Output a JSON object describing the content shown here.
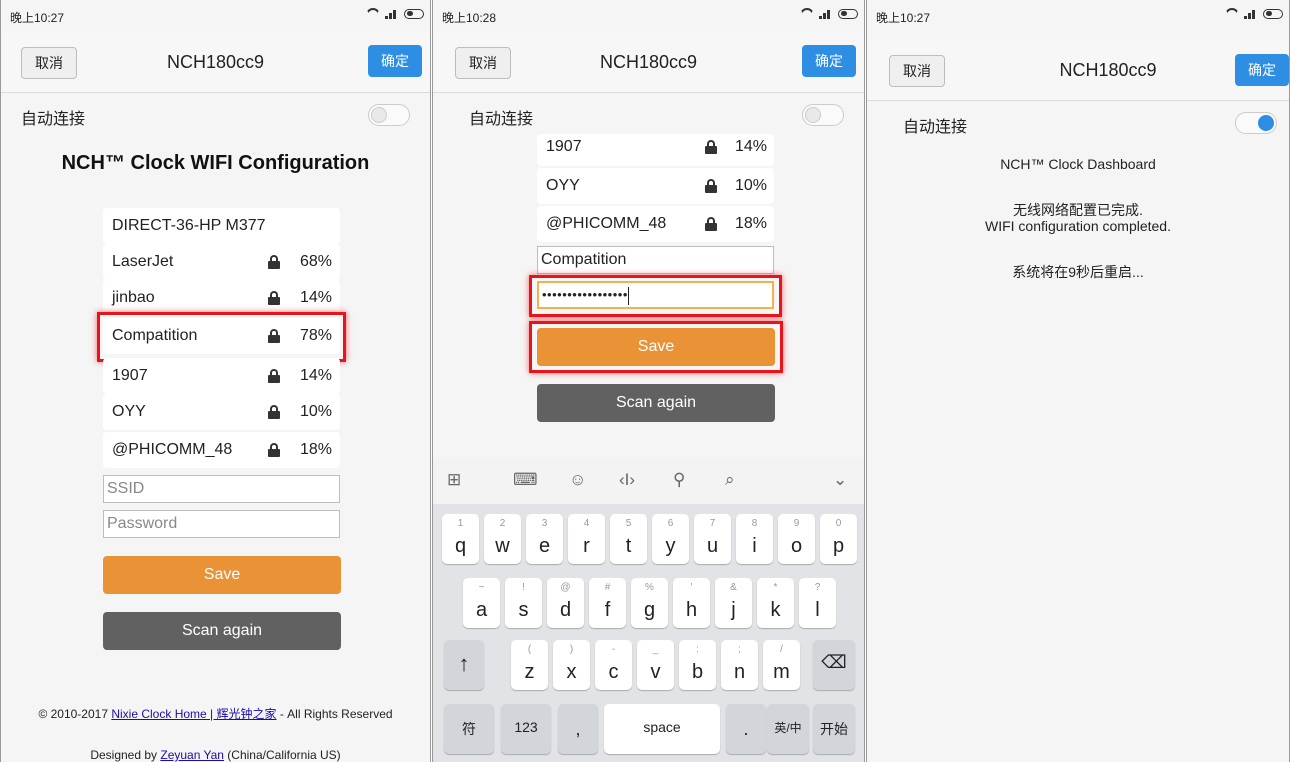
{
  "panel1": {
    "status": {
      "time": "晚上10:27"
    },
    "nav": {
      "cancel": "取消",
      "title": "NCH180cc9",
      "ok": "确定"
    },
    "auto_connect": "自动连接",
    "config_title": "NCH™ Clock WIFI Configuration",
    "networks": [
      {
        "ssid": "DIRECT-36-HP M377",
        "locked": false,
        "signal": ""
      },
      {
        "ssid": "LaserJet",
        "locked": true,
        "signal": "68%"
      },
      {
        "ssid": "jinbao",
        "locked": true,
        "signal": "14%"
      },
      {
        "ssid": "Compatition",
        "locked": true,
        "signal": "78%"
      },
      {
        "ssid": "1907",
        "locked": true,
        "signal": "14%"
      },
      {
        "ssid": "OYY",
        "locked": true,
        "signal": "10%"
      },
      {
        "ssid": "@PHICOMM_48",
        "locked": true,
        "signal": "18%"
      }
    ],
    "ssid_placeholder": "SSID",
    "password_placeholder": "Password",
    "save": "Save",
    "scan_again": "Scan again",
    "footer": {
      "copyright_prefix": "© 2010-2017 ",
      "site_link": "Nixie Clock Home | 辉光钟之家",
      "copyright_suffix": " - All Rights Reserved",
      "designed_prefix": "Designed by ",
      "designer_link": "Zeyuan Yan",
      "designed_suffix": " (China/California US)"
    }
  },
  "panel2": {
    "status": {
      "time": "晚上10:28"
    },
    "nav": {
      "cancel": "取消",
      "title": "NCH180cc9",
      "ok": "确定"
    },
    "auto_connect": "自动连接",
    "networks": [
      {
        "ssid": "1907",
        "locked": true,
        "signal": "14%"
      },
      {
        "ssid": "OYY",
        "locked": true,
        "signal": "10%"
      },
      {
        "ssid": "@PHICOMM_48",
        "locked": true,
        "signal": "18%"
      }
    ],
    "ssid_value": "Compatition",
    "password_value": "•••••••••••••••••",
    "save": "Save",
    "scan_again": "Scan again",
    "keyboard": {
      "row1": [
        {
          "k": "q",
          "s": "1"
        },
        {
          "k": "w",
          "s": "2"
        },
        {
          "k": "e",
          "s": "3"
        },
        {
          "k": "r",
          "s": "4"
        },
        {
          "k": "t",
          "s": "5"
        },
        {
          "k": "y",
          "s": "6"
        },
        {
          "k": "u",
          "s": "7"
        },
        {
          "k": "i",
          "s": "8"
        },
        {
          "k": "o",
          "s": "9"
        },
        {
          "k": "p",
          "s": "0"
        }
      ],
      "row2": [
        {
          "k": "a",
          "s": "~"
        },
        {
          "k": "s",
          "s": "!"
        },
        {
          "k": "d",
          "s": "@"
        },
        {
          "k": "f",
          "s": "#"
        },
        {
          "k": "g",
          "s": "%"
        },
        {
          "k": "h",
          "s": "'"
        },
        {
          "k": "j",
          "s": "&"
        },
        {
          "k": "k",
          "s": "*"
        },
        {
          "k": "l",
          "s": "?"
        }
      ],
      "row3": [
        {
          "k": "z",
          "s": "("
        },
        {
          "k": "x",
          "s": ")"
        },
        {
          "k": "c",
          "s": "-"
        },
        {
          "k": "v",
          "s": "_"
        },
        {
          "k": "b",
          "s": ":"
        },
        {
          "k": "n",
          "s": ";"
        },
        {
          "k": "m",
          "s": "/"
        }
      ],
      "shift": "↑",
      "backspace": "⌫",
      "symbols": "符",
      "numbers": "123",
      "comma": ",",
      "space": "space",
      "period": ".",
      "lang": "英/中",
      "start": "开始"
    }
  },
  "panel3": {
    "status": {
      "time": "晚上10:27"
    },
    "nav": {
      "cancel": "取消",
      "title": "NCH180cc9",
      "ok": "确定"
    },
    "auto_connect": "自动连接",
    "dashboard_title": "NCH™ Clock Dashboard",
    "completed_cn": "无线网络配置已完成.",
    "completed_en": "WIFI configuration completed.",
    "restart": "系统将在9秒后重启..."
  },
  "colors": {
    "accent_blue": "#2d8ee3",
    "save_orange": "#e99236",
    "scan_gray": "#616161",
    "highlight_red": "#e8141c"
  }
}
